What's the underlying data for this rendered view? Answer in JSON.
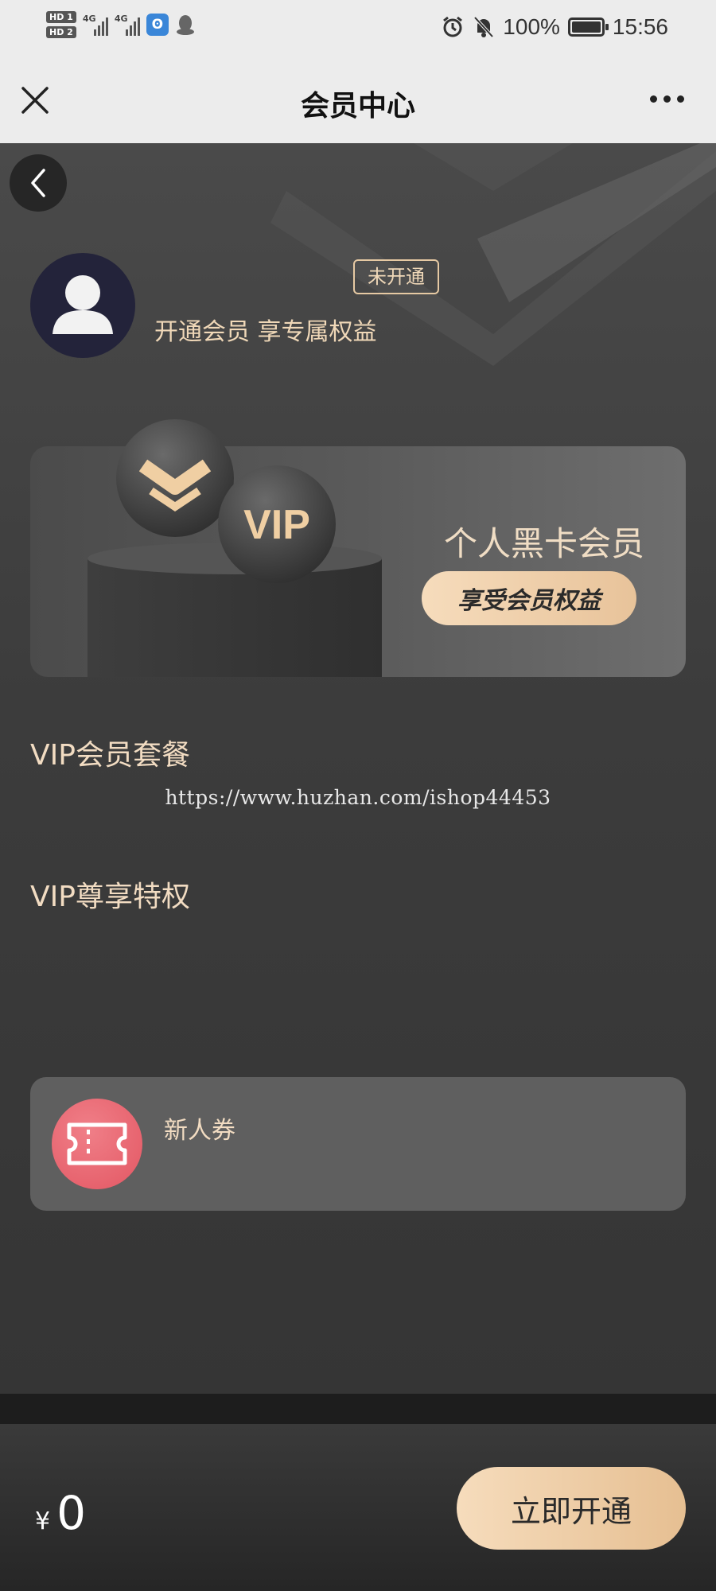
{
  "status_bar": {
    "hd1": "HD 1",
    "hd2": "HD 2",
    "net1": "4G",
    "net2": "4G",
    "battery": "100%",
    "time": "15:56",
    "icons": [
      "alarm-icon",
      "mute-icon",
      "battery-icon"
    ]
  },
  "nav": {
    "title": "会员中心"
  },
  "profile": {
    "status_badge": "未开通",
    "promo": "开通会员 享专属权益"
  },
  "card": {
    "coin_text": "VIP",
    "title": "个人黑卡会员",
    "button": "享受会员权益"
  },
  "sections": {
    "packages_title": "VIP会员套餐",
    "privileges_title": "VIP尊享特权"
  },
  "watermark": "https://www.huzhan.com/ishop44453",
  "benefits": [
    {
      "name": "新人券",
      "icon": "coupon-icon"
    }
  ],
  "footer": {
    "currency": "¥",
    "price": "0",
    "button": "立即开通"
  },
  "colors": {
    "accent_gold": "#e8c39a",
    "text_gold": "#f2dcc2",
    "coupon_red": "#e35763"
  }
}
